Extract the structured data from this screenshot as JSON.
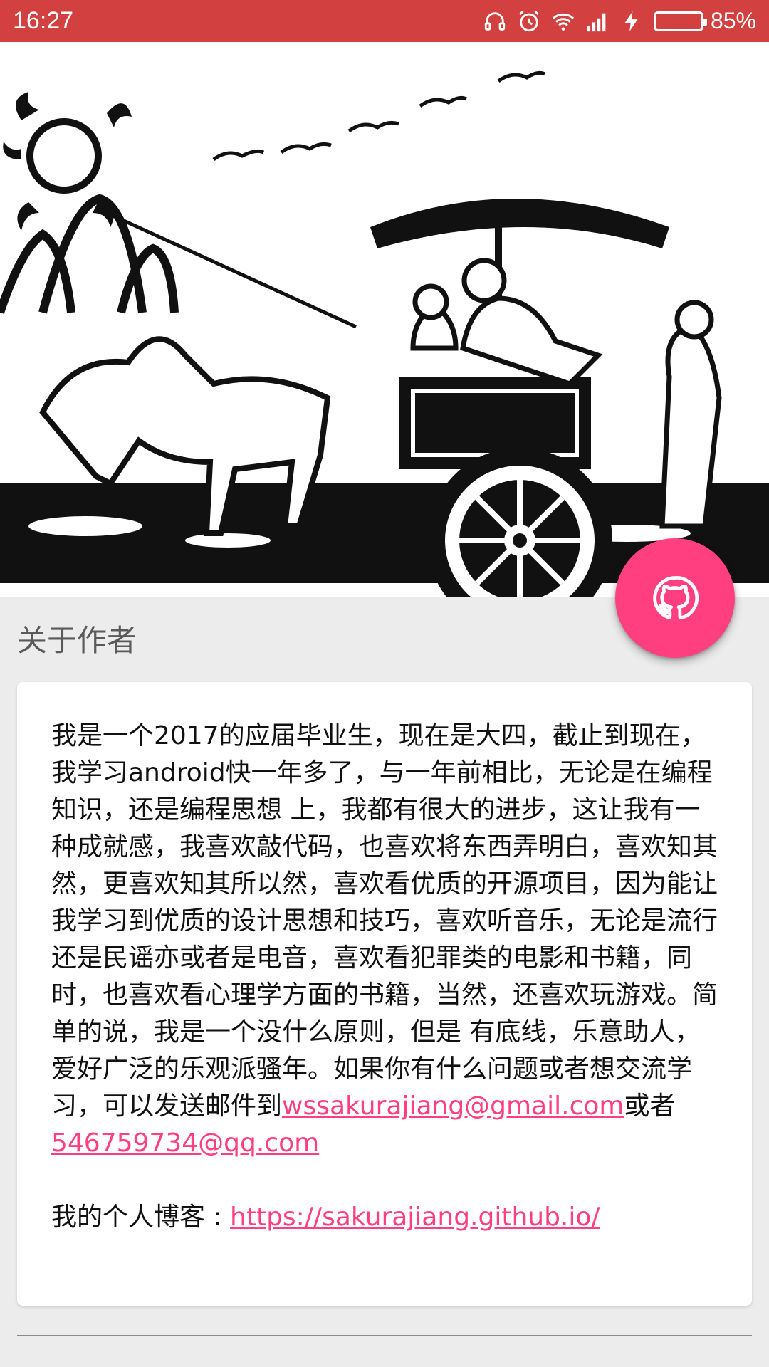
{
  "status_bar": {
    "time": "16:27",
    "battery_percent_text": "85%",
    "battery_level": 0.85,
    "icons": [
      "headset-icon",
      "alarm-icon",
      "wifi-icon",
      "signal-icon",
      "charging-icon",
      "battery-icon"
    ],
    "background_color": "#d34040"
  },
  "header": {
    "image_description_icon": "chariot-illustration"
  },
  "fab": {
    "icon": "github-icon",
    "color": "#ff3f80"
  },
  "section": {
    "title": "关于作者"
  },
  "about": {
    "text_intro": "我是一个2017的应届毕业生，现在是大四，截止到现在，我学习android快一年多了，与一年前相比，无论是在编程知识，还是编程思想 上，我都有很大的进步，这让我有一种成就感，我喜欢敲代码，也喜欢将东西弄明白，喜欢知其然，更喜欢知其所以然，喜欢看优质的开源项目，因为能让我学习到优质的设计思想和技巧，喜欢听音乐，无论是流行还是民谣亦或者是电音，喜欢看犯罪类的电影和书籍，同时，也喜欢看心理学方面的书籍，当然，还喜欢玩游戏。简单的说，我是一个没什么原则，但是 有底线，乐意助人，爱好广泛的乐观派骚年。如果你有什么问题或者想交流学习，可以发送邮件到",
    "email_gmail": "wssakurajiang@gmail.com",
    "text_or": "或者",
    "email_qq": "546759734@qq.com",
    "blog_label": "我的个人博客 : ",
    "blog_url": "https://sakurajiang.github.io/"
  }
}
